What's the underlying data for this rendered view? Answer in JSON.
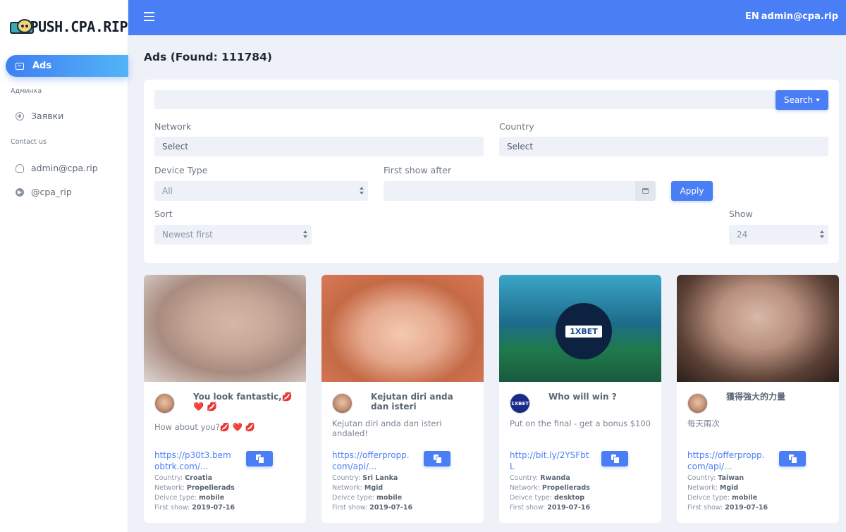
{
  "brand": {
    "name": "PUSH.CPA.RIP"
  },
  "sidebar": {
    "active_item": "Ads",
    "section_admin": "Админка",
    "item_requests": "Заявки",
    "section_contact": "Contact us",
    "contact_email": "admin@cpa.rip",
    "contact_telegram": "@cpa_rip"
  },
  "topbar": {
    "lang": "EN",
    "user": "admin@cpa.rip"
  },
  "page": {
    "title": "Ads (Found: 111784)"
  },
  "filters": {
    "search_value": "",
    "search_button": "Search",
    "network_label": "Network",
    "network_value": "Select",
    "country_label": "Country",
    "country_value": "Select",
    "device_label": "Device Type",
    "device_value": "All",
    "first_show_label": "First show after",
    "first_show_value": "",
    "apply_button": "Apply",
    "sort_label": "Sort",
    "sort_value": "Newest first",
    "show_label": "Show",
    "show_value": "24"
  },
  "meta_labels": {
    "country": "Country:",
    "network": "Network:",
    "device": "Deivce type:",
    "first_show": "First show:"
  },
  "ads": [
    {
      "title": "You look fantastic,💋❤️ 💋",
      "body": "How about you?💋 ❤️ 💋",
      "link": "https://p30t3.bemobtrk.com/...",
      "country": "Croatia",
      "network": "Propellerads",
      "device": "mobile",
      "first_show": "2019-07-16"
    },
    {
      "title": "Kejutan diri anda dan isteri",
      "body": "Kejutan diri anda dan isteri andaled!",
      "link": "https://offerpropp.com/api/...",
      "country": "Sri Lanka",
      "network": "Mgid",
      "device": "mobile",
      "first_show": "2019-07-16"
    },
    {
      "title": "Who will win ?",
      "body": "Put on the final - get a bonus $100",
      "link": "http://bit.ly/2YSFbtL",
      "country": "Rwanda",
      "network": "Propellerads",
      "device": "desktop",
      "first_show": "2019-07-16",
      "image_text": "1XBET",
      "icon_text": "1XBET"
    },
    {
      "title": "獲得強大的力量",
      "body": "每天兩次",
      "link": "https://offerpropp.com/api/...",
      "country": "Taiwan",
      "network": "Mgid",
      "device": "mobile",
      "first_show": "2019-07-16"
    }
  ]
}
